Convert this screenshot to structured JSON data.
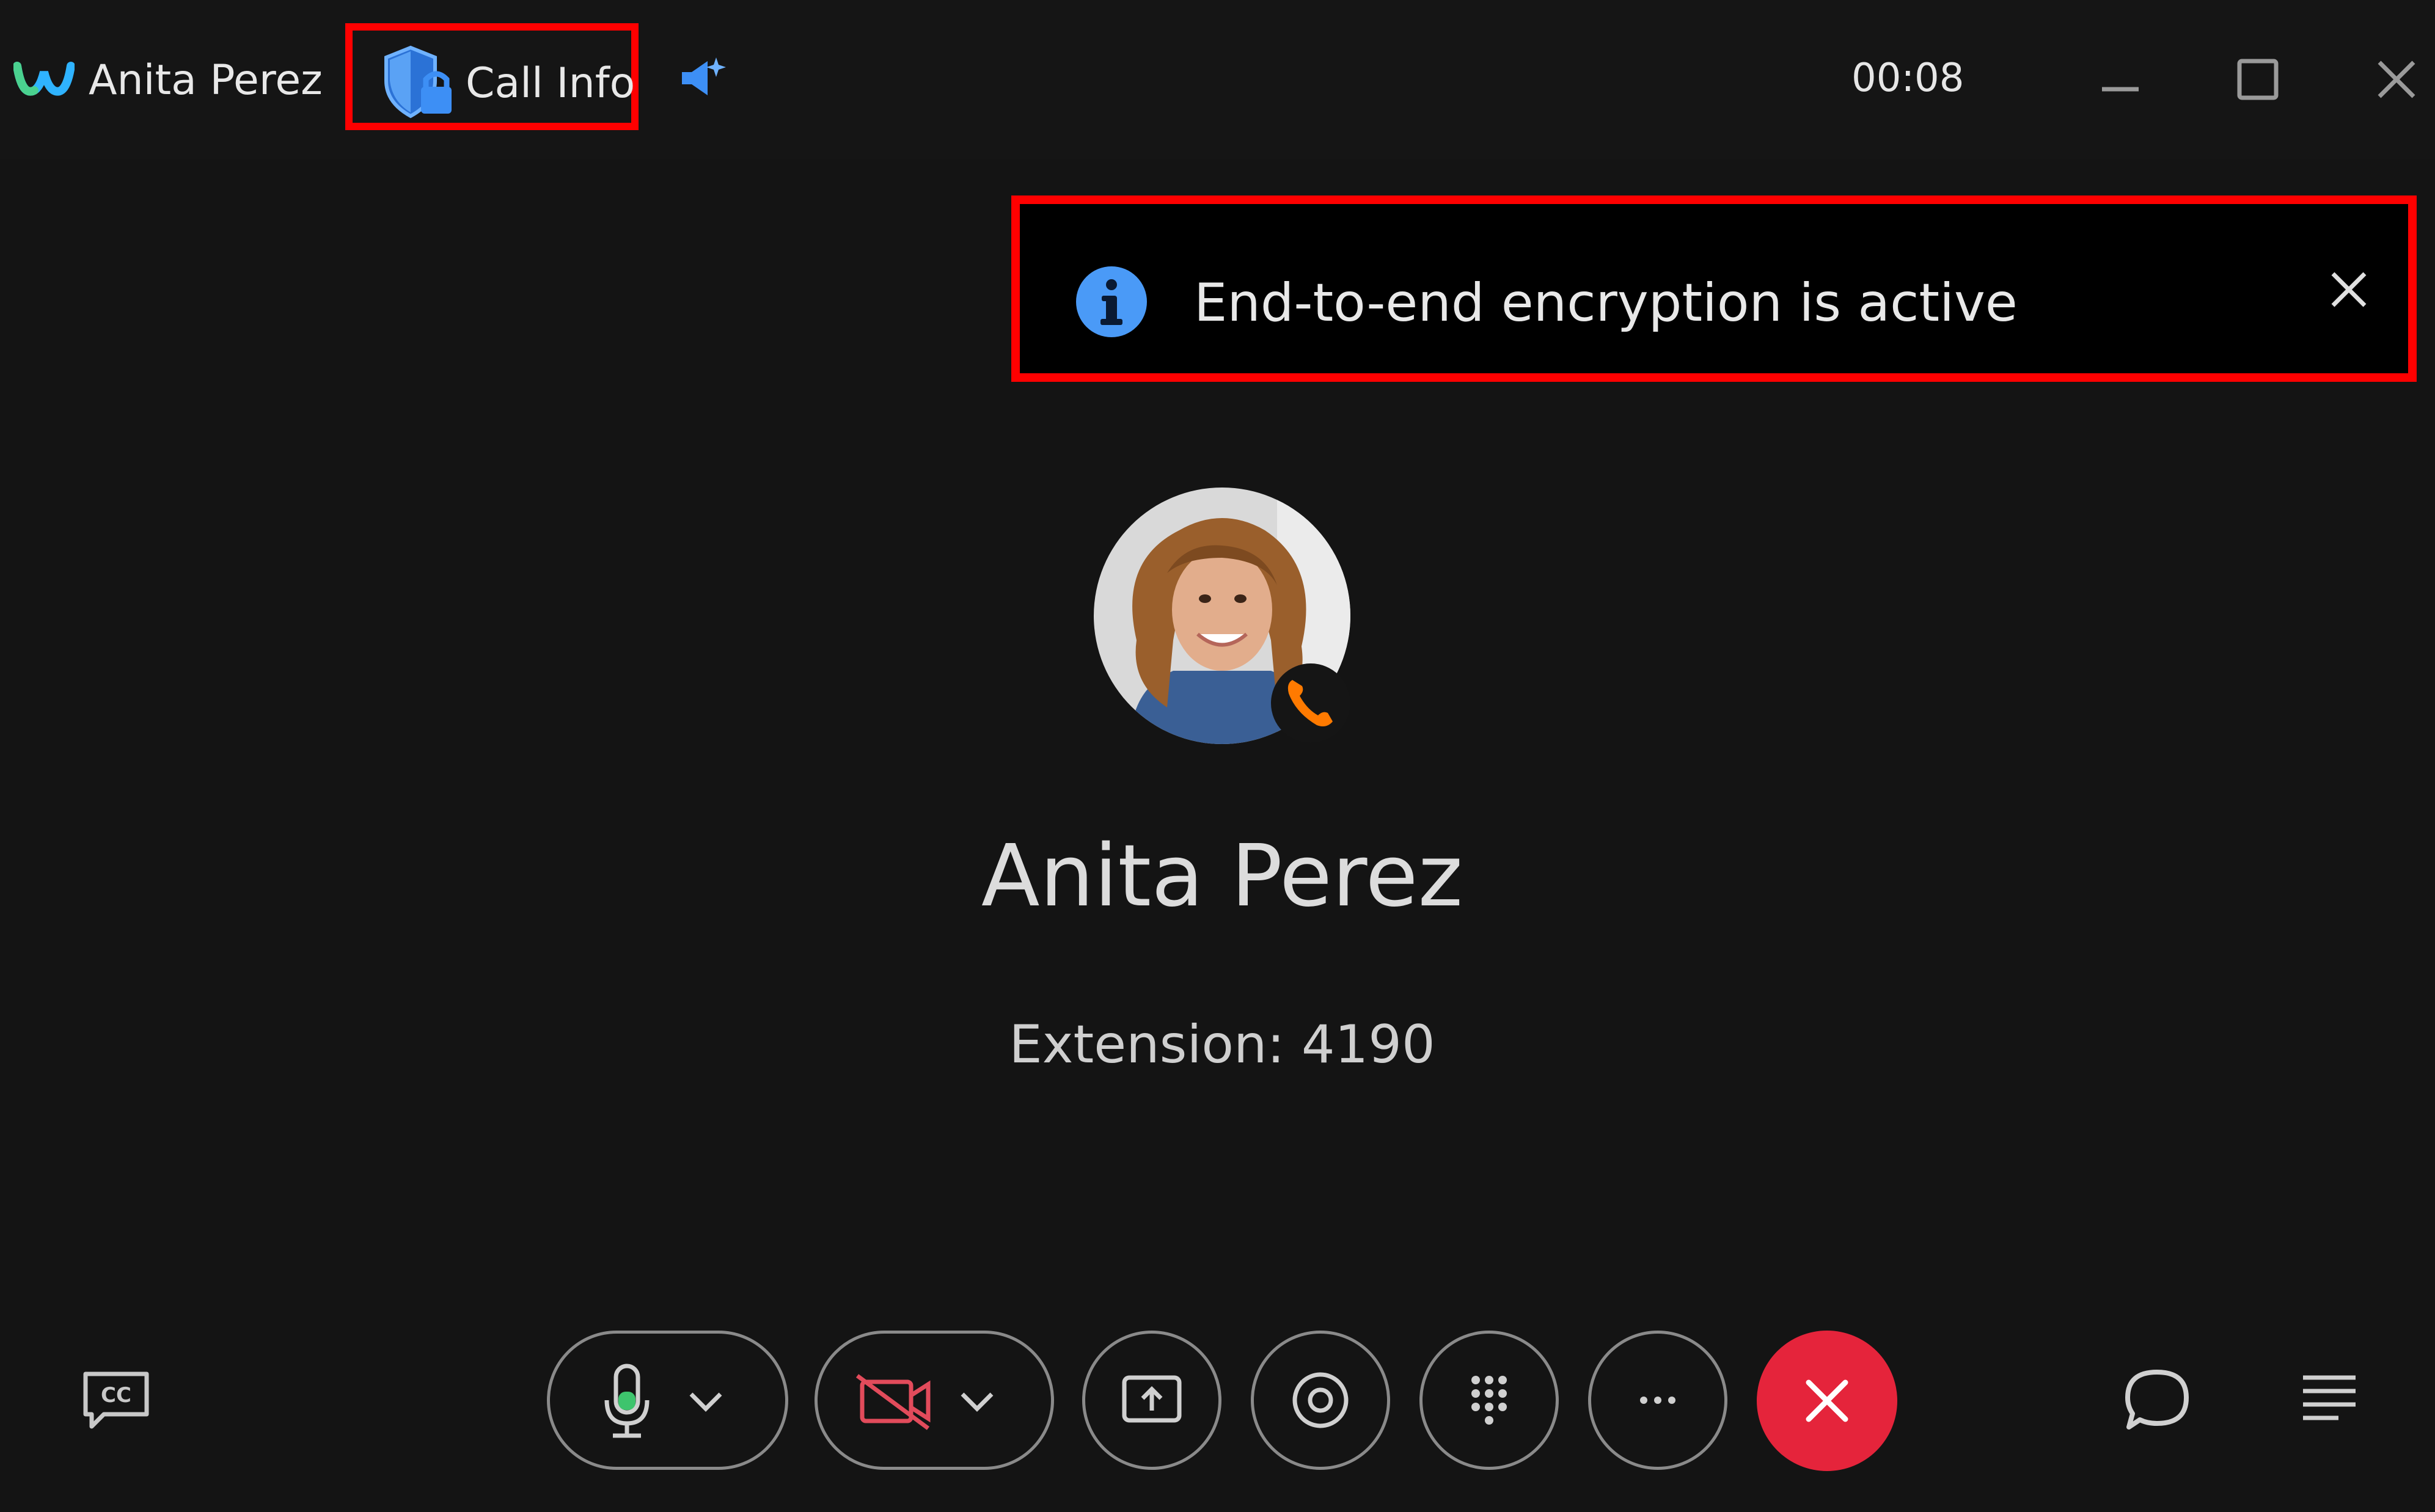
{
  "titlebar": {
    "contact_name": "Anita Perez",
    "call_info_label": "Call Info",
    "timer": "00:08",
    "icons": [
      "webex-logo-icon",
      "encryption-shield-icon",
      "ai-assistant-icon",
      "minimize-icon",
      "maximize-icon",
      "close-icon"
    ]
  },
  "banner": {
    "message": "End-to-end encryption is active",
    "icons": [
      "info-icon",
      "close-icon"
    ]
  },
  "callee": {
    "name": "Anita Perez",
    "extension": "Extension: 4190",
    "badge_icon": "phone-icon"
  },
  "controls": {
    "icons": [
      "closed-captions-icon",
      "microphone-icon",
      "video-off-icon",
      "share-screen-icon",
      "record-icon",
      "keypad-icon",
      "more-icon",
      "end-call-icon",
      "chat-icon",
      "menu-icon"
    ]
  },
  "colors": {
    "background": "#141414",
    "highlight": "#ff0000",
    "accent_blue": "#3d8ff5",
    "end_call": "#e5243b",
    "video_off": "#e24b5b",
    "phone_badge": "#ff7a00"
  }
}
